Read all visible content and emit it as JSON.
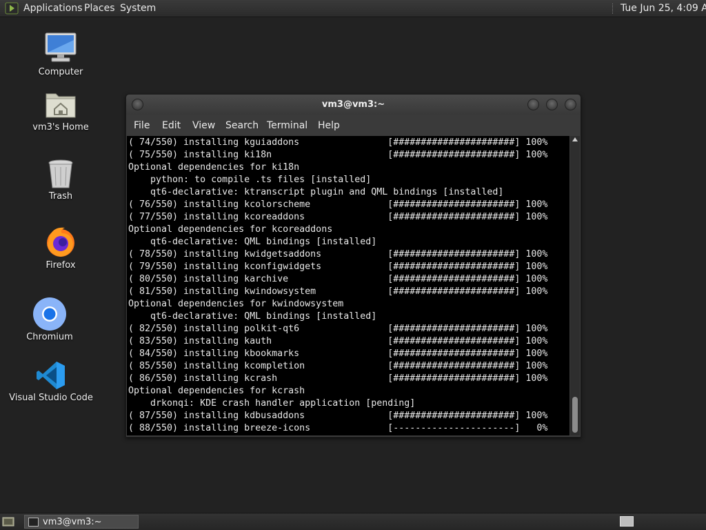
{
  "top_panel": {
    "menus": [
      "Applications",
      "Places",
      "System"
    ],
    "clock": "Tue Jun 25,  4:09 AM"
  },
  "desktop_icons": [
    {
      "label": "Computer",
      "icon": "computer-icon"
    },
    {
      "label": "vm3's Home",
      "icon": "home-folder-icon"
    },
    {
      "label": "Trash",
      "icon": "trash-icon"
    },
    {
      "label": "Firefox",
      "icon": "firefox-icon"
    },
    {
      "label": "Chromium",
      "icon": "chromium-icon"
    },
    {
      "label": "Visual Studio Code",
      "icon": "vscode-icon"
    }
  ],
  "terminal": {
    "title": "vm3@vm3:~",
    "menu": [
      "File",
      "Edit",
      "View",
      "Search",
      "Terminal",
      "Help"
    ],
    "lines": [
      "( 74/550) installing kguiaddons                [######################] 100%",
      "( 75/550) installing ki18n                     [######################] 100%",
      "Optional dependencies for ki18n",
      "    python: to compile .ts files [installed]",
      "    qt6-declarative: ktranscript plugin and QML bindings [installed]",
      "( 76/550) installing kcolorscheme              [######################] 100%",
      "( 77/550) installing kcoreaddons               [######################] 100%",
      "Optional dependencies for kcoreaddons",
      "    qt6-declarative: QML bindings [installed]",
      "( 78/550) installing kwidgetsaddons            [######################] 100%",
      "( 79/550) installing kconfigwidgets            [######################] 100%",
      "( 80/550) installing karchive                  [######################] 100%",
      "( 81/550) installing kwindowsystem             [######################] 100%",
      "Optional dependencies for kwindowsystem",
      "    qt6-declarative: QML bindings [installed]",
      "( 82/550) installing polkit-qt6                [######################] 100%",
      "( 83/550) installing kauth                     [######################] 100%",
      "( 84/550) installing kbookmarks                [######################] 100%",
      "( 85/550) installing kcompletion               [######################] 100%",
      "( 86/550) installing kcrash                    [######################] 100%",
      "Optional dependencies for kcrash",
      "    drkonqi: KDE crash handler application [pending]",
      "( 87/550) installing kdbusaddons               [######################] 100%",
      "( 88/550) installing breeze-icons              [----------------------]   0%"
    ]
  },
  "taskbar": {
    "task_label": "vm3@vm3:~"
  }
}
